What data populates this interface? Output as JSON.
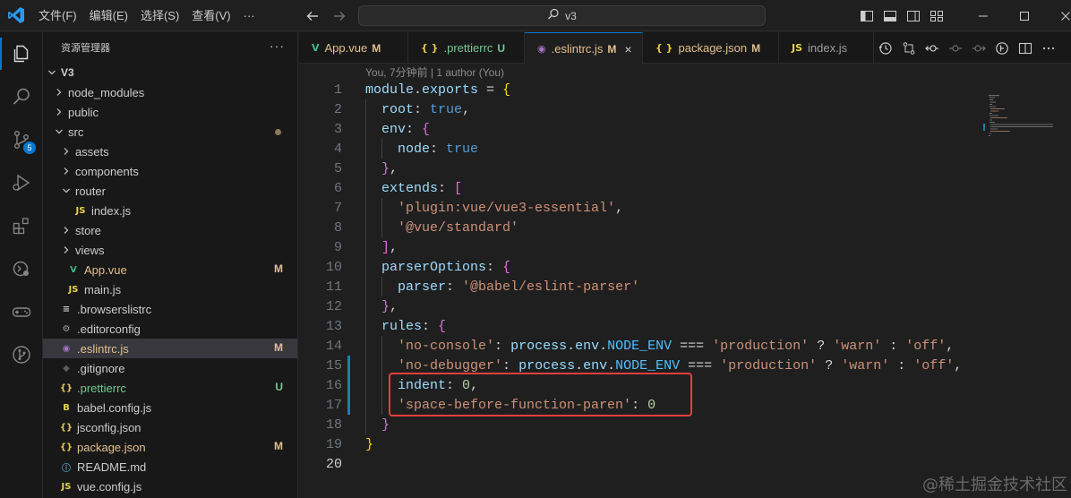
{
  "titlebar": {
    "menu": [
      "文件(F)",
      "编辑(E)",
      "选择(S)",
      "查看(V)",
      "···"
    ],
    "search_text": "v3",
    "icons": [
      "toggle-primary-sidebar-icon",
      "toggle-panel-icon",
      "toggle-secondary-sidebar-icon",
      "customize-layout-icon"
    ],
    "window_controls": [
      "minimize-icon",
      "maximize-icon",
      "close-icon"
    ]
  },
  "activity_bar": {
    "items": [
      "explorer-icon",
      "search-icon",
      "source-control-icon",
      "run-debug-icon",
      "extensions-icon",
      "remote-explorer-icon",
      "game-controller-icon",
      "git-graph-icon"
    ],
    "source_control_badge": "5"
  },
  "explorer": {
    "title": "资源管理器",
    "more": "···",
    "root": "V3",
    "items": [
      {
        "label": "node_modules",
        "depth": 1,
        "type": "folder",
        "expanded": false
      },
      {
        "label": "public",
        "depth": 1,
        "type": "folder",
        "expanded": false
      },
      {
        "label": "src",
        "depth": 1,
        "type": "folder",
        "expanded": true,
        "status_dot": true
      },
      {
        "label": "assets",
        "depth": 2,
        "type": "folder",
        "expanded": false
      },
      {
        "label": "components",
        "depth": 2,
        "type": "folder",
        "expanded": false
      },
      {
        "label": "router",
        "depth": 2,
        "type": "folder",
        "expanded": true
      },
      {
        "label": "index.js",
        "depth": 3,
        "type": "js"
      },
      {
        "label": "store",
        "depth": 2,
        "type": "folder",
        "expanded": false
      },
      {
        "label": "views",
        "depth": 2,
        "type": "folder",
        "expanded": false
      },
      {
        "label": "App.vue",
        "depth": 2,
        "type": "vue",
        "status": "M"
      },
      {
        "label": "main.js",
        "depth": 2,
        "type": "js"
      },
      {
        "label": ".browserslistrc",
        "depth": 1,
        "type": "list"
      },
      {
        "label": ".editorconfig",
        "depth": 1,
        "type": "gear"
      },
      {
        "label": ".eslintrc.js",
        "depth": 1,
        "type": "eslint",
        "status": "M",
        "selected": true
      },
      {
        "label": ".gitignore",
        "depth": 1,
        "type": "git"
      },
      {
        "label": ".prettierrc",
        "depth": 1,
        "type": "json",
        "status": "U"
      },
      {
        "label": "babel.config.js",
        "depth": 1,
        "type": "babel"
      },
      {
        "label": "jsconfig.json",
        "depth": 1,
        "type": "json"
      },
      {
        "label": "package.json",
        "depth": 1,
        "type": "json",
        "status": "M"
      },
      {
        "label": "README.md",
        "depth": 1,
        "type": "info"
      },
      {
        "label": "vue.config.js",
        "depth": 1,
        "type": "js"
      }
    ]
  },
  "tabs": [
    {
      "label": "App.vue",
      "icon": "V",
      "status": "M",
      "active": false
    },
    {
      "label": ".prettierrc",
      "icon": "{ }",
      "status": "U",
      "active": false
    },
    {
      "label": ".eslintrc.js",
      "icon": "◉",
      "status": "M",
      "active": true,
      "close": "×"
    },
    {
      "label": "package.json",
      "icon": "{ }",
      "status": "M",
      "active": false
    },
    {
      "label": "index.js",
      "icon": "JS",
      "status": "",
      "active": false
    }
  ],
  "editor_actions": [
    "timeline-icon",
    "compare-changes-icon",
    "previous-change-icon",
    "next-change-icon",
    "open-changes-icon",
    "toggle-blame-icon",
    "split-editor-icon",
    "more-actions-icon"
  ],
  "codelens": "You, 7分钟前 | 1 author (You)",
  "code_lines": [
    "module.exports = {",
    "  root: true,",
    "  env: {",
    "    node: true",
    "  },",
    "  extends: [",
    "    'plugin:vue/vue3-essential',",
    "    '@vue/standard'",
    "  ],",
    "  parserOptions: {",
    "    parser: '@babel/eslint-parser'",
    "  },",
    "  rules: {",
    "    'no-console': process.env.NODE_ENV === 'production' ? 'warn' : 'off',",
    "    'no-debugger': process.env.NODE_ENV === 'production' ? 'warn' : 'off',",
    "    indent: 0,",
    "    'space-before-function-paren': 0",
    "  }",
    "}",
    ""
  ],
  "line_numbers": [
    "1",
    "2",
    "3",
    "4",
    "5",
    "6",
    "7",
    "8",
    "9",
    "10",
    "11",
    "12",
    "13",
    "14",
    "15",
    "16",
    "17",
    "18",
    "19",
    "20"
  ],
  "current_line": 20,
  "watermark": "@稀土掘金技术社区",
  "colors": {
    "accent": "#0078d4",
    "modified": "#e2c08d",
    "untracked": "#73c991",
    "highlight_box": "#e5403d"
  }
}
